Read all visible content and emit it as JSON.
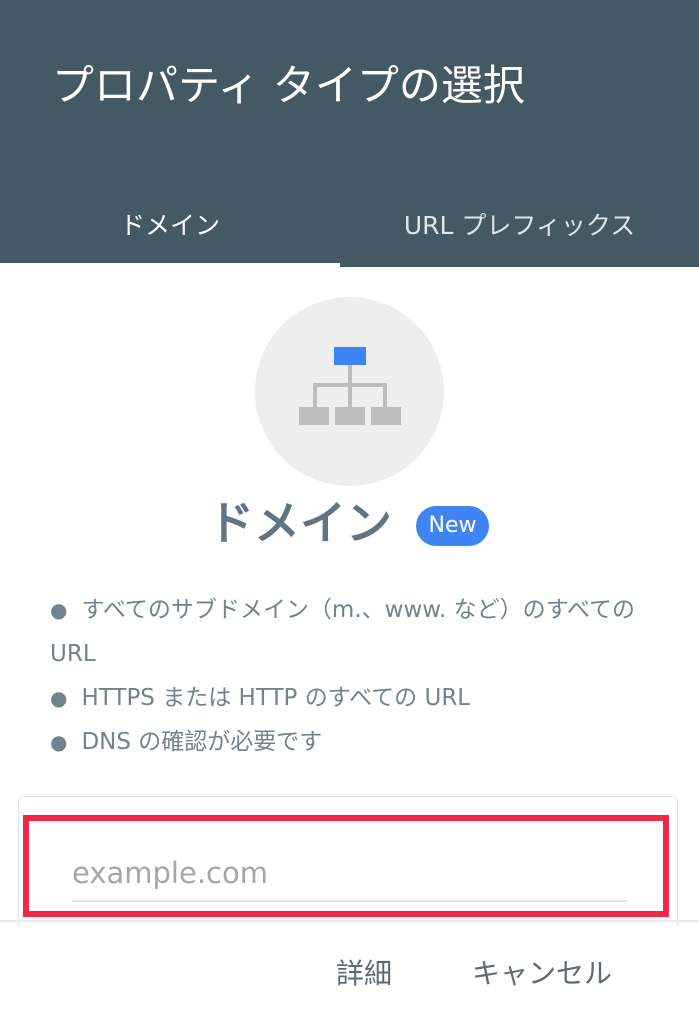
{
  "dialog": {
    "title": "プロパティ タイプの選択"
  },
  "tabs": [
    {
      "label": "ドメイン",
      "selected": true
    },
    {
      "label": "URL プレフィックス",
      "selected": false
    }
  ],
  "domain_panel": {
    "icon": "sitemap-icon",
    "heading": "ドメイン",
    "badge": "New",
    "features": [
      "すべてのサブドメイン（m.、www. など）のすべての URL",
      "HTTPS または HTTP のすべての URL",
      "DNS の確認が必要です"
    ],
    "input": {
      "value": "",
      "placeholder": "example.com"
    }
  },
  "actions": {
    "details_label": "詳細",
    "cancel_label": "キャンセル"
  },
  "colors": {
    "header_bg": "#455964",
    "badge_bg": "#3f84f3",
    "highlight": "#f1274a",
    "icon_accent": "#3f84f3",
    "icon_gray": "#bdbdbd"
  }
}
